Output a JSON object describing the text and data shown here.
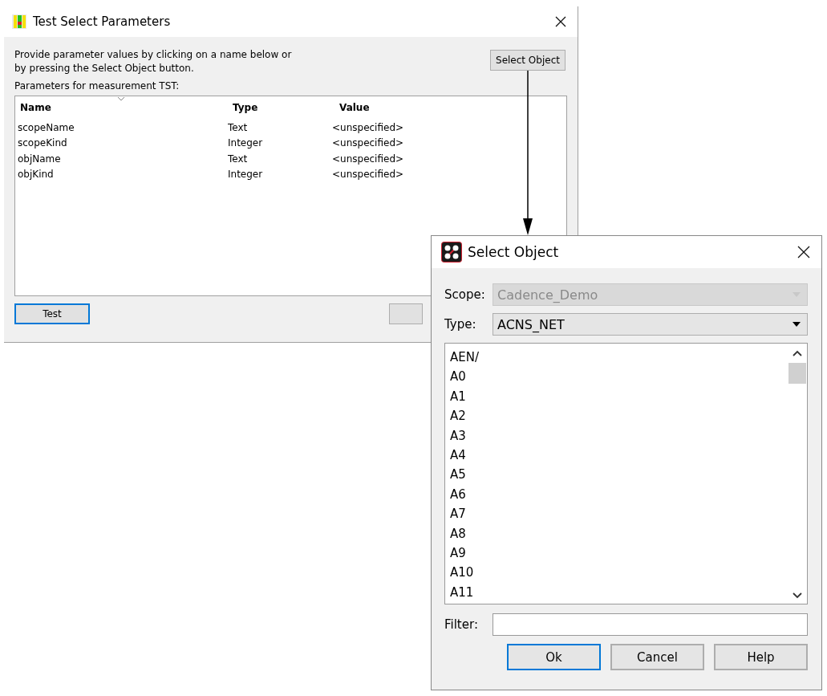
{
  "params_window": {
    "title": "Test Select Parameters",
    "instructions": "Provide parameter values by clicking on a name below or by pressing the Select Object button.",
    "select_button": "Select Object",
    "table_label": "Parameters for measurement TST:",
    "table": {
      "columns": [
        "Name",
        "Type",
        "Value"
      ],
      "rows": [
        [
          "scopeName",
          "Text",
          "<unspecified>"
        ],
        [
          "scopeKind",
          "Integer",
          "<unspecified>"
        ],
        [
          "objName",
          "Text",
          "<unspecified>"
        ],
        [
          "objKind",
          "Integer",
          "<unspecified>"
        ]
      ]
    },
    "buttons": [
      {
        "label": "Test",
        "focused": true
      }
    ]
  },
  "select_window": {
    "title": "Select Object",
    "fields": [
      {
        "label": "Scope:",
        "value": "Cadence_Demo",
        "disabled": true
      },
      {
        "label": "Type:",
        "value": "ACNS_NET",
        "disabled": false
      }
    ],
    "items": [
      "AEN/",
      "A0",
      "A1",
      "A2",
      "A3",
      "A4",
      "A5",
      "A6",
      "A7",
      "A8",
      "A9",
      "A10",
      "A11"
    ],
    "filter_label": "Filter:",
    "buttons": [
      {
        "label": "Ok",
        "focused": true
      },
      {
        "label": "Cancel",
        "focused": false
      },
      {
        "label": "Help",
        "focused": false
      }
    ]
  }
}
